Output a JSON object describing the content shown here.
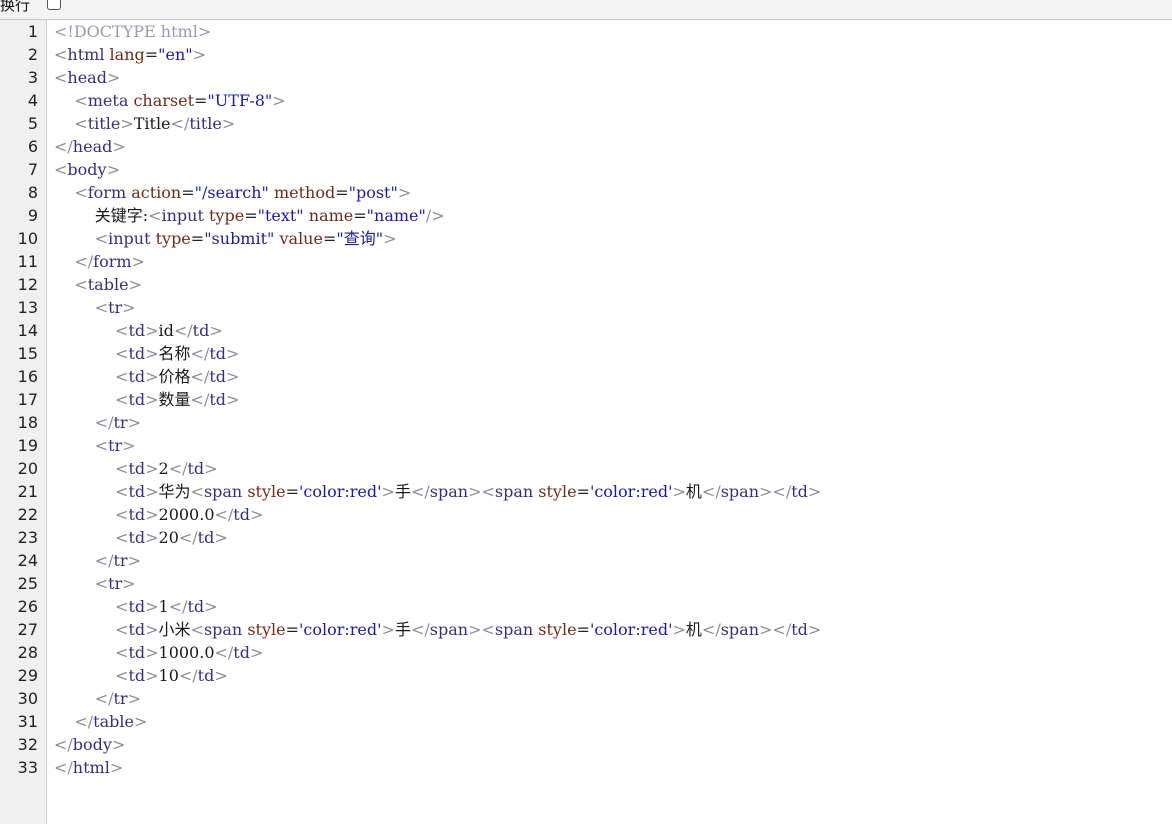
{
  "toolbar": {
    "wrap_label": "换行",
    "wrap_checked": false
  },
  "colors": {
    "bracket": "#8a8a9a",
    "tag": "#3a2e7a",
    "attr": "#6b2c1a",
    "value": "#1d1a9e",
    "doctype": "#9a9aa8",
    "text": "#1a1a1a"
  },
  "lines": [
    {
      "n": "1",
      "tokens": [
        [
          "doctype",
          "<!DOCTYPE html>"
        ]
      ]
    },
    {
      "n": "2",
      "tokens": [
        [
          "bracket",
          "<"
        ],
        [
          "tag",
          "html"
        ],
        [
          "text",
          " "
        ],
        [
          "attr",
          "lang"
        ],
        [
          "eq",
          "="
        ],
        [
          "value",
          "\"en\""
        ],
        [
          "bracket",
          ">"
        ]
      ]
    },
    {
      "n": "3",
      "tokens": [
        [
          "bracket",
          "<"
        ],
        [
          "tag",
          "head"
        ],
        [
          "bracket",
          ">"
        ]
      ]
    },
    {
      "n": "4",
      "tokens": [
        [
          "text",
          "    "
        ],
        [
          "bracket",
          "<"
        ],
        [
          "tag",
          "meta"
        ],
        [
          "text",
          " "
        ],
        [
          "attr",
          "charset"
        ],
        [
          "eq",
          "="
        ],
        [
          "value",
          "\"UTF-8\""
        ],
        [
          "bracket",
          ">"
        ]
      ]
    },
    {
      "n": "5",
      "tokens": [
        [
          "text",
          "    "
        ],
        [
          "bracket",
          "<"
        ],
        [
          "tag",
          "title"
        ],
        [
          "bracket",
          ">"
        ],
        [
          "text",
          "Title"
        ],
        [
          "bracket",
          "</"
        ],
        [
          "tag",
          "title"
        ],
        [
          "bracket",
          ">"
        ]
      ]
    },
    {
      "n": "6",
      "tokens": [
        [
          "bracket",
          "</"
        ],
        [
          "tag",
          "head"
        ],
        [
          "bracket",
          ">"
        ]
      ]
    },
    {
      "n": "7",
      "tokens": [
        [
          "bracket",
          "<"
        ],
        [
          "tag",
          "body"
        ],
        [
          "bracket",
          ">"
        ]
      ]
    },
    {
      "n": "8",
      "tokens": [
        [
          "text",
          "    "
        ],
        [
          "bracket",
          "<"
        ],
        [
          "tag",
          "form"
        ],
        [
          "text",
          " "
        ],
        [
          "attr",
          "action"
        ],
        [
          "eq",
          "="
        ],
        [
          "value",
          "\"/search\""
        ],
        [
          "text",
          " "
        ],
        [
          "attr",
          "method"
        ],
        [
          "eq",
          "="
        ],
        [
          "value",
          "\"post\""
        ],
        [
          "bracket",
          ">"
        ]
      ]
    },
    {
      "n": "9",
      "tokens": [
        [
          "text",
          "        关键字:"
        ],
        [
          "bracket",
          "<"
        ],
        [
          "tag",
          "input"
        ],
        [
          "text",
          " "
        ],
        [
          "attr",
          "type"
        ],
        [
          "eq",
          "="
        ],
        [
          "value",
          "\"text\""
        ],
        [
          "text",
          " "
        ],
        [
          "attr",
          "name"
        ],
        [
          "eq",
          "="
        ],
        [
          "value",
          "\"name\""
        ],
        [
          "bracket",
          "/>"
        ]
      ]
    },
    {
      "n": "10",
      "tokens": [
        [
          "text",
          "        "
        ],
        [
          "bracket",
          "<"
        ],
        [
          "tag",
          "input"
        ],
        [
          "text",
          " "
        ],
        [
          "attr",
          "type"
        ],
        [
          "eq",
          "="
        ],
        [
          "value",
          "\"submit\""
        ],
        [
          "text",
          " "
        ],
        [
          "attr",
          "value"
        ],
        [
          "eq",
          "="
        ],
        [
          "value",
          "\"查询\""
        ],
        [
          "bracket",
          ">"
        ]
      ]
    },
    {
      "n": "11",
      "tokens": [
        [
          "text",
          "    "
        ],
        [
          "bracket",
          "</"
        ],
        [
          "tag",
          "form"
        ],
        [
          "bracket",
          ">"
        ]
      ]
    },
    {
      "n": "12",
      "tokens": [
        [
          "text",
          "    "
        ],
        [
          "bracket",
          "<"
        ],
        [
          "tag",
          "table"
        ],
        [
          "bracket",
          ">"
        ]
      ]
    },
    {
      "n": "13",
      "tokens": [
        [
          "text",
          "        "
        ],
        [
          "bracket",
          "<"
        ],
        [
          "tag",
          "tr"
        ],
        [
          "bracket",
          ">"
        ]
      ]
    },
    {
      "n": "14",
      "tokens": [
        [
          "text",
          "            "
        ],
        [
          "bracket",
          "<"
        ],
        [
          "tag",
          "td"
        ],
        [
          "bracket",
          ">"
        ],
        [
          "text",
          "id"
        ],
        [
          "bracket",
          "</"
        ],
        [
          "tag",
          "td"
        ],
        [
          "bracket",
          ">"
        ]
      ]
    },
    {
      "n": "15",
      "tokens": [
        [
          "text",
          "            "
        ],
        [
          "bracket",
          "<"
        ],
        [
          "tag",
          "td"
        ],
        [
          "bracket",
          ">"
        ],
        [
          "text",
          "名称"
        ],
        [
          "bracket",
          "</"
        ],
        [
          "tag",
          "td"
        ],
        [
          "bracket",
          ">"
        ]
      ]
    },
    {
      "n": "16",
      "tokens": [
        [
          "text",
          "            "
        ],
        [
          "bracket",
          "<"
        ],
        [
          "tag",
          "td"
        ],
        [
          "bracket",
          ">"
        ],
        [
          "text",
          "价格"
        ],
        [
          "bracket",
          "</"
        ],
        [
          "tag",
          "td"
        ],
        [
          "bracket",
          ">"
        ]
      ]
    },
    {
      "n": "17",
      "tokens": [
        [
          "text",
          "            "
        ],
        [
          "bracket",
          "<"
        ],
        [
          "tag",
          "td"
        ],
        [
          "bracket",
          ">"
        ],
        [
          "text",
          "数量"
        ],
        [
          "bracket",
          "</"
        ],
        [
          "tag",
          "td"
        ],
        [
          "bracket",
          ">"
        ]
      ]
    },
    {
      "n": "18",
      "tokens": [
        [
          "text",
          "        "
        ],
        [
          "bracket",
          "</"
        ],
        [
          "tag",
          "tr"
        ],
        [
          "bracket",
          ">"
        ]
      ]
    },
    {
      "n": "19",
      "tokens": [
        [
          "text",
          "        "
        ],
        [
          "bracket",
          "<"
        ],
        [
          "tag",
          "tr"
        ],
        [
          "bracket",
          ">"
        ]
      ]
    },
    {
      "n": "20",
      "tokens": [
        [
          "text",
          "            "
        ],
        [
          "bracket",
          "<"
        ],
        [
          "tag",
          "td"
        ],
        [
          "bracket",
          ">"
        ],
        [
          "text",
          "2"
        ],
        [
          "bracket",
          "</"
        ],
        [
          "tag",
          "td"
        ],
        [
          "bracket",
          ">"
        ]
      ]
    },
    {
      "n": "21",
      "tokens": [
        [
          "text",
          "            "
        ],
        [
          "bracket",
          "<"
        ],
        [
          "tag",
          "td"
        ],
        [
          "bracket",
          ">"
        ],
        [
          "text",
          "华为"
        ],
        [
          "bracket",
          "<"
        ],
        [
          "tag",
          "span"
        ],
        [
          "text",
          " "
        ],
        [
          "attr",
          "style"
        ],
        [
          "eq",
          "="
        ],
        [
          "value",
          "'color:red'"
        ],
        [
          "bracket",
          ">"
        ],
        [
          "text",
          "手"
        ],
        [
          "bracket",
          "</"
        ],
        [
          "tag",
          "span"
        ],
        [
          "bracket",
          "><"
        ],
        [
          "tag",
          "span"
        ],
        [
          "text",
          " "
        ],
        [
          "attr",
          "style"
        ],
        [
          "eq",
          "="
        ],
        [
          "value",
          "'color:red'"
        ],
        [
          "bracket",
          ">"
        ],
        [
          "text",
          "机"
        ],
        [
          "bracket",
          "</"
        ],
        [
          "tag",
          "span"
        ],
        [
          "bracket",
          "></"
        ],
        [
          "tag",
          "td"
        ],
        [
          "bracket",
          ">"
        ]
      ]
    },
    {
      "n": "22",
      "tokens": [
        [
          "text",
          "            "
        ],
        [
          "bracket",
          "<"
        ],
        [
          "tag",
          "td"
        ],
        [
          "bracket",
          ">"
        ],
        [
          "text",
          "2000.0"
        ],
        [
          "bracket",
          "</"
        ],
        [
          "tag",
          "td"
        ],
        [
          "bracket",
          ">"
        ]
      ]
    },
    {
      "n": "23",
      "tokens": [
        [
          "text",
          "            "
        ],
        [
          "bracket",
          "<"
        ],
        [
          "tag",
          "td"
        ],
        [
          "bracket",
          ">"
        ],
        [
          "text",
          "20"
        ],
        [
          "bracket",
          "</"
        ],
        [
          "tag",
          "td"
        ],
        [
          "bracket",
          ">"
        ]
      ]
    },
    {
      "n": "24",
      "tokens": [
        [
          "text",
          "        "
        ],
        [
          "bracket",
          "</"
        ],
        [
          "tag",
          "tr"
        ],
        [
          "bracket",
          ">"
        ]
      ]
    },
    {
      "n": "25",
      "tokens": [
        [
          "text",
          "        "
        ],
        [
          "bracket",
          "<"
        ],
        [
          "tag",
          "tr"
        ],
        [
          "bracket",
          ">"
        ]
      ]
    },
    {
      "n": "26",
      "tokens": [
        [
          "text",
          "            "
        ],
        [
          "bracket",
          "<"
        ],
        [
          "tag",
          "td"
        ],
        [
          "bracket",
          ">"
        ],
        [
          "text",
          "1"
        ],
        [
          "bracket",
          "</"
        ],
        [
          "tag",
          "td"
        ],
        [
          "bracket",
          ">"
        ]
      ]
    },
    {
      "n": "27",
      "tokens": [
        [
          "text",
          "            "
        ],
        [
          "bracket",
          "<"
        ],
        [
          "tag",
          "td"
        ],
        [
          "bracket",
          ">"
        ],
        [
          "text",
          "小米"
        ],
        [
          "bracket",
          "<"
        ],
        [
          "tag",
          "span"
        ],
        [
          "text",
          " "
        ],
        [
          "attr",
          "style"
        ],
        [
          "eq",
          "="
        ],
        [
          "value",
          "'color:red'"
        ],
        [
          "bracket",
          ">"
        ],
        [
          "text",
          "手"
        ],
        [
          "bracket",
          "</"
        ],
        [
          "tag",
          "span"
        ],
        [
          "bracket",
          "><"
        ],
        [
          "tag",
          "span"
        ],
        [
          "text",
          " "
        ],
        [
          "attr",
          "style"
        ],
        [
          "eq",
          "="
        ],
        [
          "value",
          "'color:red'"
        ],
        [
          "bracket",
          ">"
        ],
        [
          "text",
          "机"
        ],
        [
          "bracket",
          "</"
        ],
        [
          "tag",
          "span"
        ],
        [
          "bracket",
          "></"
        ],
        [
          "tag",
          "td"
        ],
        [
          "bracket",
          ">"
        ]
      ]
    },
    {
      "n": "28",
      "tokens": [
        [
          "text",
          "            "
        ],
        [
          "bracket",
          "<"
        ],
        [
          "tag",
          "td"
        ],
        [
          "bracket",
          ">"
        ],
        [
          "text",
          "1000.0"
        ],
        [
          "bracket",
          "</"
        ],
        [
          "tag",
          "td"
        ],
        [
          "bracket",
          ">"
        ]
      ]
    },
    {
      "n": "29",
      "tokens": [
        [
          "text",
          "            "
        ],
        [
          "bracket",
          "<"
        ],
        [
          "tag",
          "td"
        ],
        [
          "bracket",
          ">"
        ],
        [
          "text",
          "10"
        ],
        [
          "bracket",
          "</"
        ],
        [
          "tag",
          "td"
        ],
        [
          "bracket",
          ">"
        ]
      ]
    },
    {
      "n": "30",
      "tokens": [
        [
          "text",
          "        "
        ],
        [
          "bracket",
          "</"
        ],
        [
          "tag",
          "tr"
        ],
        [
          "bracket",
          ">"
        ]
      ]
    },
    {
      "n": "31",
      "tokens": [
        [
          "text",
          "    "
        ],
        [
          "bracket",
          "</"
        ],
        [
          "tag",
          "table"
        ],
        [
          "bracket",
          ">"
        ]
      ]
    },
    {
      "n": "32",
      "tokens": [
        [
          "bracket",
          "</"
        ],
        [
          "tag",
          "body"
        ],
        [
          "bracket",
          ">"
        ]
      ]
    },
    {
      "n": "33",
      "tokens": [
        [
          "bracket",
          "</"
        ],
        [
          "tag",
          "html"
        ],
        [
          "bracket",
          ">"
        ]
      ]
    }
  ]
}
